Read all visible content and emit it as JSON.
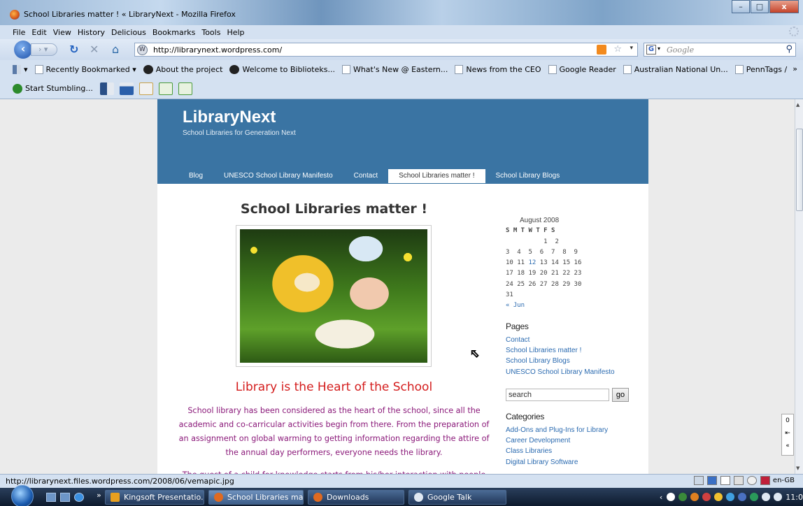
{
  "window": {
    "title": "School Libraries matter ! « LibraryNext - Mozilla Firefox",
    "min": "–",
    "max": "□",
    "close": "x"
  },
  "menu": [
    "File",
    "Edit",
    "View",
    "History",
    "Delicious",
    "Bookmarks",
    "Tools",
    "Help"
  ],
  "nav": {
    "url": "http://librarynext.wordpress.com/",
    "search_placeholder": "Google"
  },
  "bookmarks": {
    "recently_bookmarked": "Recently Bookmarked",
    "items": [
      "About the project",
      "Welcome to Biblioteks...",
      "What's New @ Eastern...",
      "News from the CEO",
      "Google Reader",
      "Australian National Un...",
      "PennTags /"
    ],
    "more": "»"
  },
  "stumble": {
    "label": "Start Stumbling..."
  },
  "blog": {
    "title": "LibraryNext",
    "tagline": "School Libraries for Generation Next",
    "nav": [
      "Blog",
      "UNESCO School Library Manifesto",
      "Contact",
      "School Libraries matter !",
      "School Library Blogs"
    ],
    "post_title": "School Libraries matter !",
    "subheading": "Library is the Heart of the School",
    "body": "School library has been considered as the heart of the school, since all the academic and co-carricular activities begin from there. From the preparation of an assignment on global warming to getting information regarding the attire of the annual day performers, everyone needs the library.",
    "body_cut": "The quest of a child for knowledge starts from his/her interaction with people"
  },
  "sidebar": {
    "calendar": {
      "month": "August 2008",
      "dow": "S M T W T F S",
      "rows": [
        "          1  2",
        "3  4  5  6  7  8  9",
        "10 11 12 13 14 15 16",
        "17 18 19 20 21 22 23",
        "24 25 26 27 28 29 30",
        "31"
      ],
      "prev": "« Jun"
    },
    "pages_heading": "Pages",
    "pages": [
      "Contact",
      "School Libraries matter !",
      "School Library Blogs",
      "UNESCO School Library Manifesto"
    ],
    "search_value": "search",
    "go_label": "go",
    "categories_heading": "Categories",
    "categories": [
      "Add-Ons and Plug-Ins for Library",
      "Career Development",
      "Class Libraries",
      "Digital Library Software"
    ]
  },
  "status": {
    "text": "http://librarynext.files.wordpress.com/2008/06/vemapic.jpg",
    "lang": "en-GB"
  },
  "side_widget": {
    "count": "0"
  },
  "taskbar": {
    "tasks": [
      "Kingsoft Presentatio...",
      "School Libraries mat...",
      "Downloads",
      "Google Talk"
    ],
    "clock": "11:0",
    "quick_more": "»"
  },
  "colors": {
    "header_blue": "#3a74a3",
    "body_purple": "#8b1a7a",
    "subhead_red": "#d41c1c",
    "link_blue": "#2a6ab0"
  }
}
